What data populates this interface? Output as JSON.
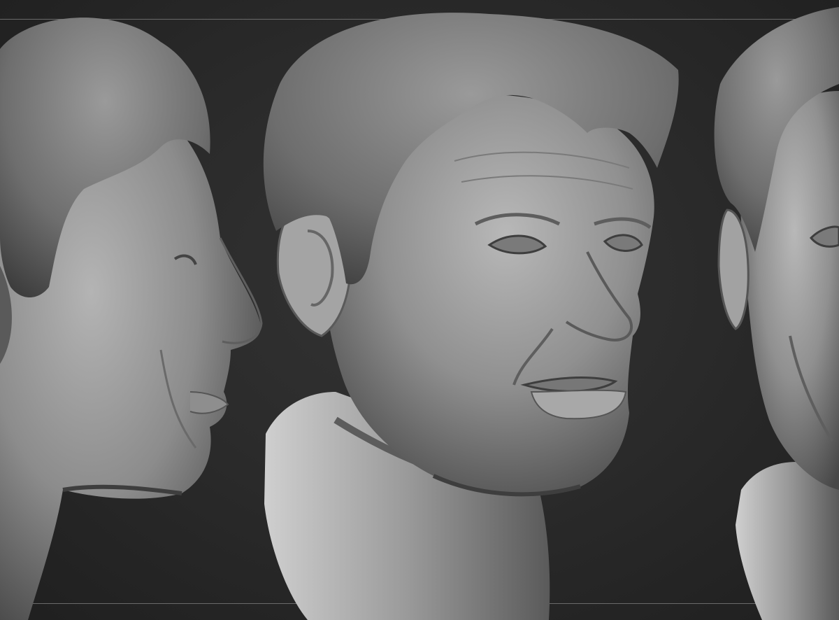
{
  "viewport": {
    "background": "#2b2b2b",
    "guide_color": "#6a6a6a",
    "material_color": "#9a9a9a"
  },
  "views": [
    {
      "name": "left-profile-view"
    },
    {
      "name": "three-quarter-view"
    },
    {
      "name": "right-front-view"
    }
  ]
}
